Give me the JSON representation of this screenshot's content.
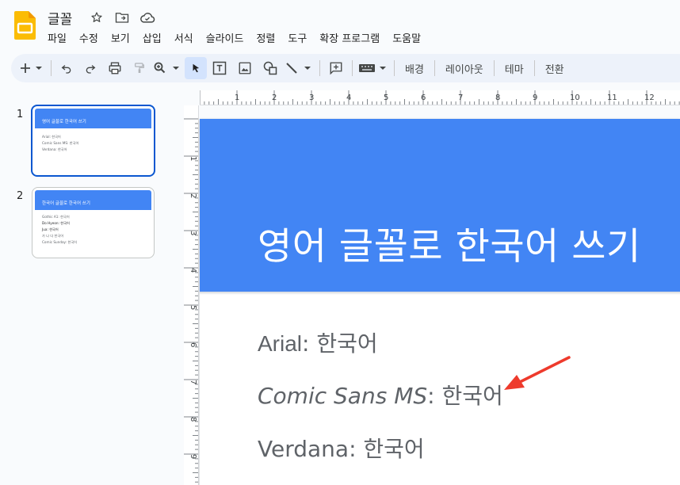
{
  "app": {
    "doc_title": "글꼴",
    "icons": [
      "star-icon",
      "move-to-folder-icon",
      "cloud-status-icon"
    ]
  },
  "menu": [
    "파일",
    "수정",
    "보기",
    "삽입",
    "서식",
    "슬라이드",
    "정렬",
    "도구",
    "확장 프로그램",
    "도움말"
  ],
  "toolbar": {
    "background_label": "배경",
    "layout_label": "레이아웃",
    "theme_label": "테마",
    "transition_label": "전환"
  },
  "rulers": {
    "horizontal": [
      "1",
      "2",
      "3",
      "4",
      "5",
      "6",
      "7",
      "8",
      "9",
      "10",
      "11",
      "12"
    ],
    "vertical": [
      "1",
      "2",
      "3",
      "4",
      "5",
      "6",
      "7",
      "8",
      "9"
    ]
  },
  "filmstrip": [
    {
      "number": "1",
      "title": "영어 글꼴로 한국어 쓰기",
      "lines": [
        "Arial: 한국어",
        "Comic Sans MS: 한국어",
        "Verdana: 한국어"
      ],
      "selected": true
    },
    {
      "number": "2",
      "title": "한국어 글꼴로 한국어 쓰기",
      "lines": [
        "Gothic A1: 한국어",
        "Do Hyeon: 한국어",
        "Jua: 한국어",
        "가 나 다 한국어",
        "Comic Sunday: 한국어"
      ],
      "selected": false
    }
  ],
  "slide": {
    "title": "영어 글꼴로 한국어 쓰기",
    "lines": [
      {
        "font": "Arial",
        "text": ": 한국어"
      },
      {
        "font": "Comic Sans MS",
        "text": ": 한국어"
      },
      {
        "font": "Verdana",
        "text": ": 한국어"
      }
    ]
  },
  "colors": {
    "accent_blue": "#4285f4",
    "selection_blue": "#0b57d0",
    "arrow_red": "#ee3a2c"
  }
}
